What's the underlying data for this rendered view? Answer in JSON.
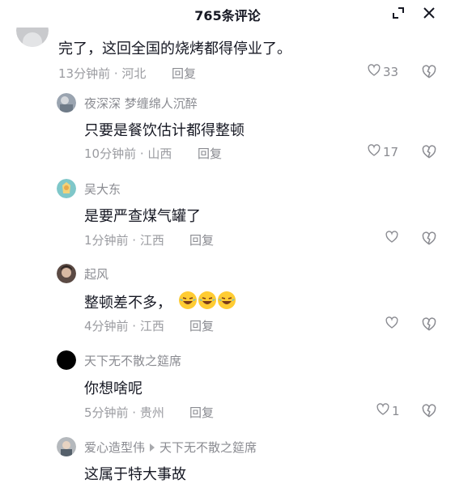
{
  "header": {
    "title": "765条评论",
    "expand_icon": "expand-icon",
    "close_icon": "close-icon"
  },
  "comments": [
    {
      "text": "完了，这回全国的烧烤都得停业了。",
      "meta": "13分钟前 · 河北",
      "reply_label": "回复",
      "likes": "33"
    },
    {
      "author": "夜深深 梦缠绵人沉醉",
      "text": "只要是餐饮估计都得整顿",
      "meta": "10分钟前 · 山西",
      "reply_label": "回复",
      "likes": "17"
    },
    {
      "author": "吴大东",
      "text": "是要严查煤气罐了",
      "meta": "1分钟前 · 江西",
      "reply_label": "回复",
      "likes": ""
    },
    {
      "author": "起风",
      "text": "整顿差不多，",
      "emoji": [
        "laugh-cry-emoji",
        "laugh-cry-emoji",
        "laugh-cry-emoji"
      ],
      "meta": "4分钟前 · 江西",
      "reply_label": "回复",
      "likes": ""
    },
    {
      "author": "天下无不散之筵席",
      "text": "你想啥呢",
      "meta": "5分钟前 · 贵州",
      "reply_label": "回复",
      "likes": "1"
    },
    {
      "author": "爱心造型伟",
      "reply_to": "天下无不散之筵席",
      "text": "这属于特大事故"
    }
  ],
  "icons": {
    "like": "heart-outline-icon",
    "dislike": "broken-heart-icon"
  },
  "colors": {
    "text_primary": "#161823",
    "text_secondary": "#8a8b91",
    "background": "#ffffff"
  }
}
